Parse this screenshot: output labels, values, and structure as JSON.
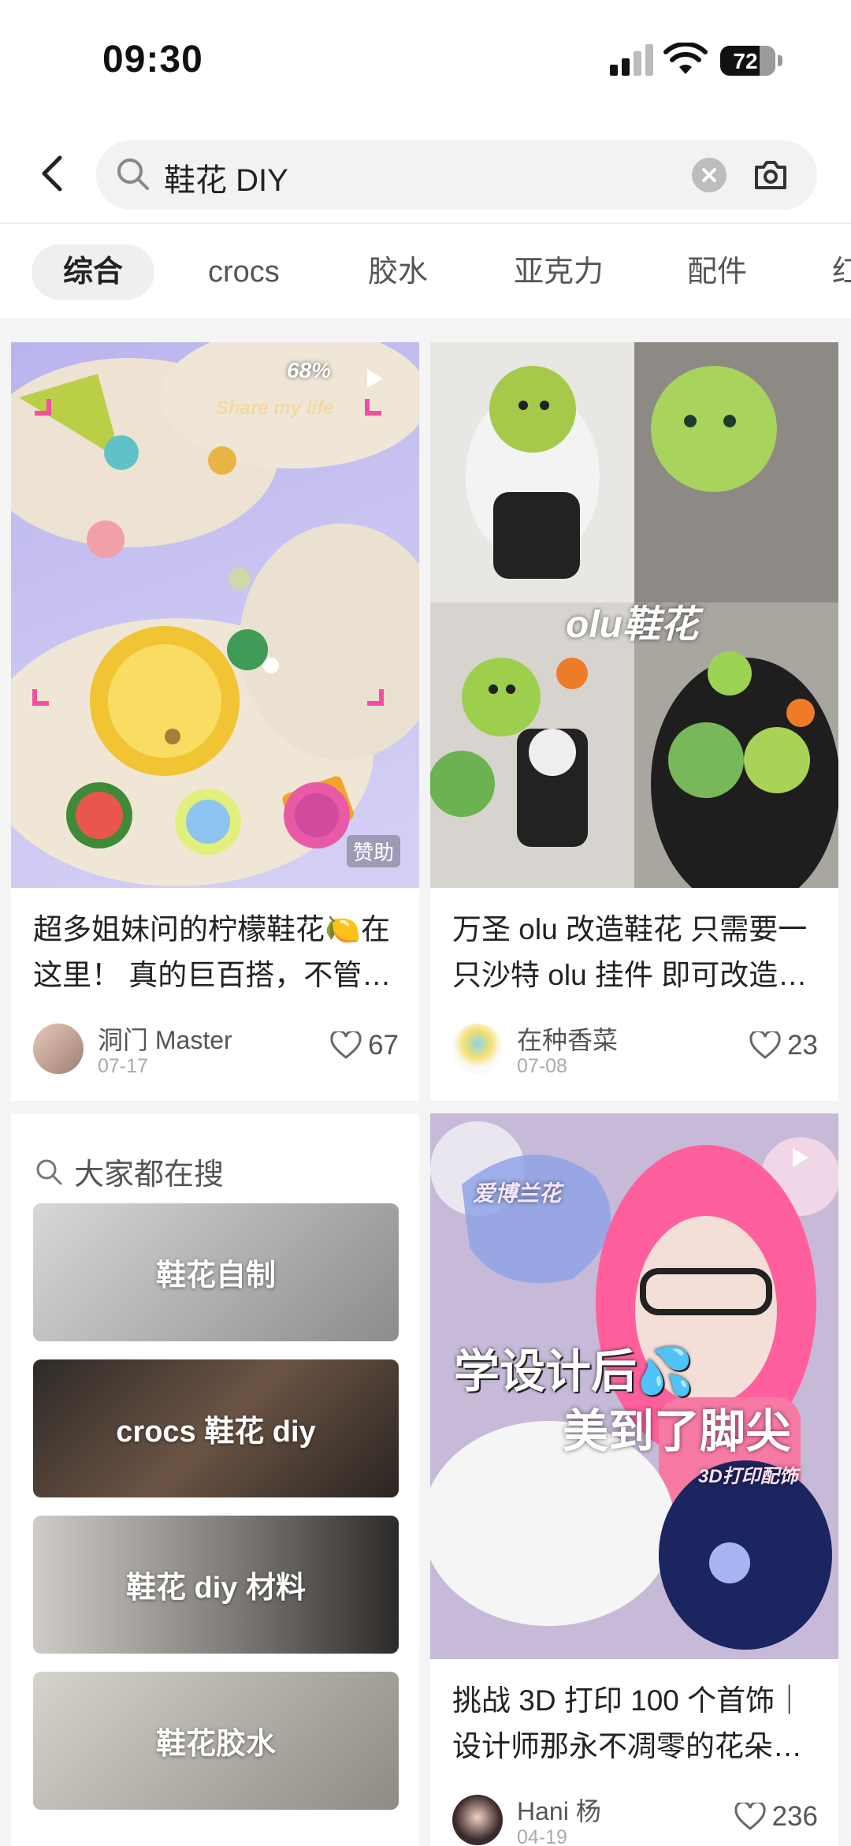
{
  "status_bar": {
    "time": "09:30",
    "battery": "72",
    "battery_level": 0.72
  },
  "search": {
    "query": "鞋花 DIY",
    "icons": [
      "back-icon",
      "search-icon",
      "clear-icon",
      "camera-icon"
    ]
  },
  "tabs": [
    {
      "label": "综合",
      "active": true
    },
    {
      "label": "crocs"
    },
    {
      "label": "胶水"
    },
    {
      "label": "亚克力"
    },
    {
      "label": "配件"
    },
    {
      "label": "红"
    }
  ],
  "feed": {
    "left_card": {
      "title": "超多姐妹问的柠檬鞋花🍋在这里！ 真的巨百搭，不管是…",
      "author": "洞门 Master",
      "date": "07-17",
      "likes": "67",
      "cover_badge": "赞助",
      "cover_text": "68%",
      "cover_script": "Share my life"
    },
    "right_card_1": {
      "title": "万圣 olu 改造鞋花 只需要一只沙特 olu 挂件 即可改造…",
      "author": "在种香菜",
      "date": "07-08",
      "likes": "23",
      "cover_text": "olu鞋花"
    },
    "right_card_2": {
      "title": "挑战 3D 打印 100 个首饰｜设计师那永不凋零的花朵…",
      "author": "Hani 杨",
      "date": "04-19",
      "likes": "236",
      "cover_line1": "学设计后💦",
      "cover_line2": "美到了脚尖",
      "cover_small1": "爱博兰花",
      "cover_small2": "3D打印配饰"
    },
    "hot_searches": {
      "heading": "大家都在搜",
      "items": [
        "鞋花自制",
        "crocs 鞋花 diy",
        "鞋花 diy 材料",
        "鞋花胶水"
      ]
    }
  }
}
